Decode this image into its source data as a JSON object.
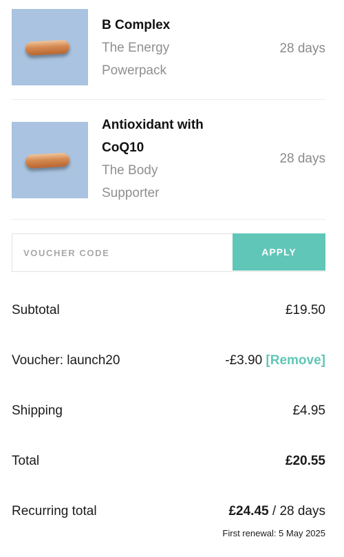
{
  "products": [
    {
      "name": "B Complex",
      "subtitle_lines": [
        "The Energy",
        "Powerpack"
      ],
      "duration": "28 days",
      "image_icon": "capsule-icon"
    },
    {
      "name_lines": [
        "Antioxidant with",
        "CoQ10"
      ],
      "subtitle_lines": [
        "The Body",
        "Supporter"
      ],
      "duration": "28 days",
      "image_icon": "capsule-icon"
    }
  ],
  "voucher": {
    "placeholder": "VOUCHER CODE",
    "value": "",
    "apply_label": "APPLY"
  },
  "summary": {
    "subtotal_label": "Subtotal",
    "subtotal_value": "£19.50",
    "voucher_label": "Voucher: launch20",
    "voucher_value": "-£3.90",
    "remove_label": "[Remove]",
    "shipping_label": "Shipping",
    "shipping_value": "£4.95",
    "total_label": "Total",
    "total_value": "£20.55",
    "recurring_label": "Recurring total",
    "recurring_value": "£24.45",
    "recurring_period": "/ 28 days",
    "first_renewal": "First renewal: 5 May 2025"
  },
  "colors": {
    "accent": "#60c6b7",
    "thumb_bg": "#a9c3e0",
    "muted_text": "#8f8f8f"
  }
}
